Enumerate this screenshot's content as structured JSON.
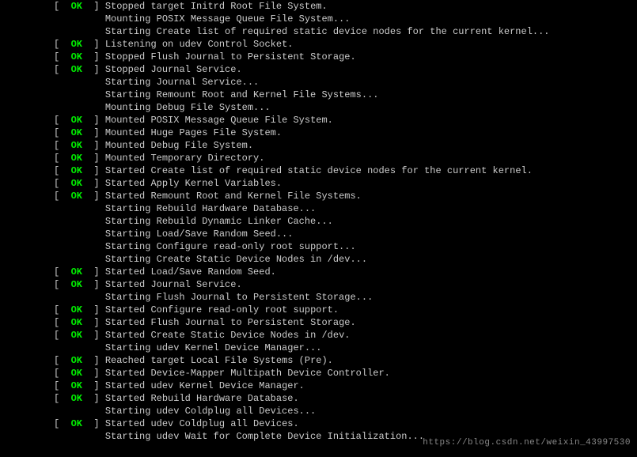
{
  "lines": [
    {
      "status": "OK",
      "msg": "Stopped target Initrd Root File System."
    },
    {
      "status": null,
      "msg": "Mounting POSIX Message Queue File System..."
    },
    {
      "status": null,
      "msg": "Starting Create list of required static device nodes for the current kernel..."
    },
    {
      "status": "OK",
      "msg": "Listening on udev Control Socket."
    },
    {
      "status": "OK",
      "msg": "Stopped Flush Journal to Persistent Storage."
    },
    {
      "status": "OK",
      "msg": "Stopped Journal Service."
    },
    {
      "status": null,
      "msg": "Starting Journal Service..."
    },
    {
      "status": null,
      "msg": "Starting Remount Root and Kernel File Systems..."
    },
    {
      "status": null,
      "msg": "Mounting Debug File System..."
    },
    {
      "status": "OK",
      "msg": "Mounted POSIX Message Queue File System."
    },
    {
      "status": "OK",
      "msg": "Mounted Huge Pages File System."
    },
    {
      "status": "OK",
      "msg": "Mounted Debug File System."
    },
    {
      "status": "OK",
      "msg": "Mounted Temporary Directory."
    },
    {
      "status": "OK",
      "msg": "Started Create list of required static device nodes for the current kernel."
    },
    {
      "status": "OK",
      "msg": "Started Apply Kernel Variables."
    },
    {
      "status": "OK",
      "msg": "Started Remount Root and Kernel File Systems."
    },
    {
      "status": null,
      "msg": "Starting Rebuild Hardware Database..."
    },
    {
      "status": null,
      "msg": "Starting Rebuild Dynamic Linker Cache..."
    },
    {
      "status": null,
      "msg": "Starting Load/Save Random Seed..."
    },
    {
      "status": null,
      "msg": "Starting Configure read-only root support..."
    },
    {
      "status": null,
      "msg": "Starting Create Static Device Nodes in /dev..."
    },
    {
      "status": "OK",
      "msg": "Started Load/Save Random Seed."
    },
    {
      "status": "OK",
      "msg": "Started Journal Service."
    },
    {
      "status": null,
      "msg": "Starting Flush Journal to Persistent Storage..."
    },
    {
      "status": "OK",
      "msg": "Started Configure read-only root support."
    },
    {
      "status": "OK",
      "msg": "Started Flush Journal to Persistent Storage."
    },
    {
      "status": "OK",
      "msg": "Started Create Static Device Nodes in /dev."
    },
    {
      "status": null,
      "msg": "Starting udev Kernel Device Manager..."
    },
    {
      "status": "OK",
      "msg": "Reached target Local File Systems (Pre)."
    },
    {
      "status": "OK",
      "msg": "Started Device-Mapper Multipath Device Controller."
    },
    {
      "status": "OK",
      "msg": "Started udev Kernel Device Manager."
    },
    {
      "status": "OK",
      "msg": "Started Rebuild Hardware Database."
    },
    {
      "status": null,
      "msg": "Starting udev Coldplug all Devices..."
    },
    {
      "status": "OK",
      "msg": "Started udev Coldplug all Devices."
    },
    {
      "status": null,
      "msg": "Starting udev Wait for Complete Device Initialization..."
    }
  ],
  "watermark": "https://blog.csdn.net/weixin_43997530"
}
